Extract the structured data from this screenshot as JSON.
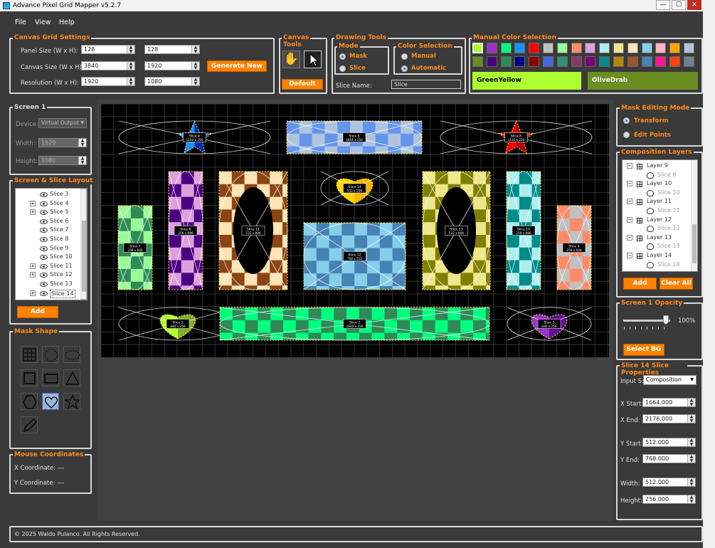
{
  "window": {
    "title": "Advance Pixel Grid Mapper v5.2.7",
    "min": "—",
    "max": "☐",
    "close": "✕"
  },
  "menu": [
    "File",
    "View",
    "Help"
  ],
  "canvas_grid": {
    "title": "Canvas  Grid Settings",
    "panel_label": "Panel Size (W x H):",
    "panel_w": "128",
    "panel_h": "128",
    "canvas_label": "Canvas Size (W x H):",
    "canvas_w": "3840",
    "canvas_h": "1920",
    "res_label": "Resolution (W x H):",
    "res_w": "1920",
    "res_h": "1080",
    "generate": "Generate New"
  },
  "canvas_tools": {
    "title": "Canvas Tools",
    "default": "Default"
  },
  "drawing_tools": {
    "title": "Drawing Tools",
    "mode_title": "Mode",
    "mask": "Mask",
    "slice": "Slice",
    "color_title": "Color Selection",
    "manual": "Manual",
    "automatic": "Automatic",
    "slice_name_label": "Slice Name:",
    "slice_name": "Slice"
  },
  "manual_color": {
    "title": "Manual Color Selection",
    "row1": [
      "#adff2f",
      "#9932cc",
      "#00ff7f",
      "#1e90ff",
      "#ff0000",
      "#c0c0c0",
      "#98fb98",
      "#ff8c69",
      "#dda0dd",
      "#afeeee",
      "#f0e68c",
      "#ffe4b5",
      "#87ceeb",
      "#ffb6c1",
      "#ffa500",
      "#b0c4de"
    ],
    "row2": [
      "#6b8e23",
      "#4b0082",
      "#2e8b57",
      "#00008b",
      "#8b0000",
      "#4169e1",
      "#2f8f6f",
      "#8b3a62",
      "#800080",
      "#008b8b",
      "#b8860b",
      "#a0522d",
      "#4682b4",
      "#ff1493",
      "#ff4500",
      "#708090"
    ],
    "primary_name": "GreenYellow",
    "primary_color": "#adff2f",
    "secondary_name": "OliveDrab",
    "secondary_color": "#6b8e23"
  },
  "screen": {
    "title": "Screen 1",
    "device_label": "Device:",
    "device": "Virtual Output",
    "width_label": "Width:",
    "width": "1920",
    "height_label": "Height:",
    "height": "1080"
  },
  "slice_layout": {
    "title": "Screen & Slice Layout",
    "items": [
      {
        "label": "Slice 3",
        "plus": false
      },
      {
        "label": "Slice 4",
        "plus": true
      },
      {
        "label": "Slice 5",
        "plus": true
      },
      {
        "label": "Slice 6",
        "plus": false
      },
      {
        "label": "Slice 7",
        "plus": false
      },
      {
        "label": "Slice 8",
        "plus": false
      },
      {
        "label": "Slice 9",
        "plus": false
      },
      {
        "label": "Slice 10",
        "plus": false
      },
      {
        "label": "Slice 11",
        "plus": true
      },
      {
        "label": "Slice 12",
        "plus": true
      },
      {
        "label": "Slice 13",
        "plus": false
      },
      {
        "label": "Slice 14",
        "plus": true
      }
    ],
    "add": "Add"
  },
  "mask_shape": {
    "title": "Mask Shape"
  },
  "mouse": {
    "title": "Mouse Coordinates",
    "x_label": "X Coordinate:",
    "x": "---",
    "y_label": "Y Coordinate:",
    "y": "---"
  },
  "mask_edit": {
    "title": "Mask Editing Mode",
    "transform": "Transform",
    "edit_points": "Edit Points"
  },
  "layers": {
    "title": "Composition Layers",
    "items": [
      {
        "label": "Layer 9",
        "type": "layer"
      },
      {
        "label": "Slice 9",
        "type": "slice"
      },
      {
        "label": "Layer 10",
        "type": "layer"
      },
      {
        "label": "Slice 10",
        "type": "slice"
      },
      {
        "label": "Layer 11",
        "type": "layer"
      },
      {
        "label": "Slice 11",
        "type": "slice"
      },
      {
        "label": "Layer 12",
        "type": "layer"
      },
      {
        "label": "Slice 12",
        "type": "slice"
      },
      {
        "label": "Layer 13",
        "type": "layer"
      },
      {
        "label": "Slice 13",
        "type": "slice"
      },
      {
        "label": "Layer 14",
        "type": "layer"
      },
      {
        "label": "Slice 14",
        "type": "slice"
      }
    ],
    "add": "Add",
    "clear": "Clear All"
  },
  "opacity": {
    "title": "Screen 1 Opacity",
    "value": "100%",
    "level": 1.0,
    "select_bg": "Select BG"
  },
  "slice_props": {
    "title": "Slice 14 Slice Properties",
    "input_label": "Input S:",
    "input": "Composition",
    "xs_label": "X Start:",
    "xs": "1664.000",
    "xe_label": "X End:",
    "xe": "2176.000",
    "ys_label": "Y Start:",
    "ys": "512.000",
    "ye_label": "Y End:",
    "ye": "768.000",
    "w_label": "Width:",
    "w": "512.000",
    "h_label": "Height:",
    "h": "256.000"
  },
  "footer": "© 2025 Waldo Pulanco. All Rights Reserved.",
  "canvas_slices": [
    {
      "label": "Slice 1",
      "size": "640 x 256"
    },
    {
      "label": "Slice 2",
      "size": "1920 x 256"
    },
    {
      "label": "Slice 3",
      "size": "640 x 256"
    },
    {
      "label": "Slice 4",
      "size": "1152 x 256"
    },
    {
      "label": "Slice 5",
      "size": "1664 x 256"
    },
    {
      "label": "Slice 6",
      "size": "1152 x 256"
    },
    {
      "label": "Slice 7",
      "size": "256 x 640"
    },
    {
      "label": "Slice 8",
      "size": "256 x 896"
    },
    {
      "label": "Slice 9",
      "size": "256 x 640"
    },
    {
      "label": "Slice 10",
      "size": "256 x 896"
    },
    {
      "label": "Slice 11",
      "size": "512 x 896"
    },
    {
      "label": "Slice 12",
      "size": "768 x 512"
    },
    {
      "label": "Slice 13",
      "size": "512 x 896"
    },
    {
      "label": "Slice 14",
      "size": "512 x 256"
    }
  ]
}
